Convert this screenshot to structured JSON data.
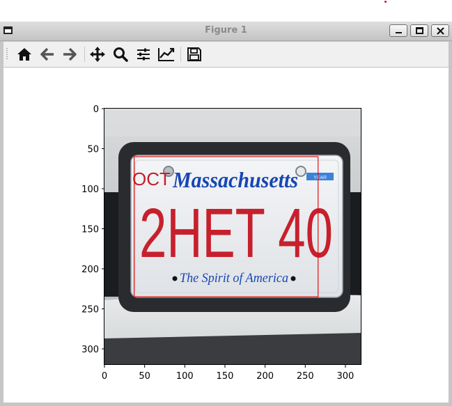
{
  "window": {
    "title": "Figure 1"
  },
  "toolbar": {
    "buttons": [
      {
        "name": "home-icon",
        "tooltip": "Home"
      },
      {
        "name": "back-icon",
        "tooltip": "Back"
      },
      {
        "name": "forward-icon",
        "tooltip": "Forward"
      },
      {
        "name": "pan-icon",
        "tooltip": "Pan"
      },
      {
        "name": "zoom-icon",
        "tooltip": "Zoom"
      },
      {
        "name": "subplots-icon",
        "tooltip": "Subplots"
      },
      {
        "name": "customize-icon",
        "tooltip": "Customize"
      },
      {
        "name": "save-icon",
        "tooltip": "Save"
      }
    ]
  },
  "chart_data": {
    "type": "image",
    "xlim": [
      0,
      320
    ],
    "ylim": [
      320,
      0
    ],
    "x_ticks": [
      "0",
      "50",
      "100",
      "150",
      "200",
      "250",
      "300"
    ],
    "y_ticks": [
      "0",
      "50",
      "100",
      "150",
      "200",
      "250",
      "300"
    ],
    "bounding_box": {
      "x_min": 37,
      "y_min": 60,
      "x_max": 266,
      "y_max": 235,
      "color": "#e01010"
    },
    "image": {
      "plate_month": "OCT",
      "plate_state": "Massachusetts",
      "plate_sticker": "YEAR",
      "plate_number": "2HET 40",
      "plate_slogan": "The Spirit of America"
    }
  }
}
